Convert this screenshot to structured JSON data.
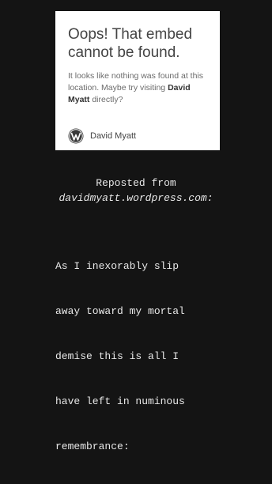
{
  "embed": {
    "title": "Oops! That embed cannot be found.",
    "message_before": "It looks like nothing was found at this location. Maybe try visiting ",
    "message_link": "David Myatt",
    "message_after": " directly?",
    "site_name": "David Myatt",
    "site_icon": "wordpress-icon"
  },
  "post": {
    "repost_prefix": "Reposted from",
    "repost_source": "davidmyatt.wordpress.com:",
    "lines": [
      "As I inexorably slip",
      "away toward my mortal",
      "demise this is all I",
      "have left in numinous",
      "remembrance:"
    ]
  },
  "colors": {
    "page_background": "#141414",
    "card_background": "#ffffff",
    "title_text": "#444444",
    "body_text": "#e8e8e8"
  }
}
